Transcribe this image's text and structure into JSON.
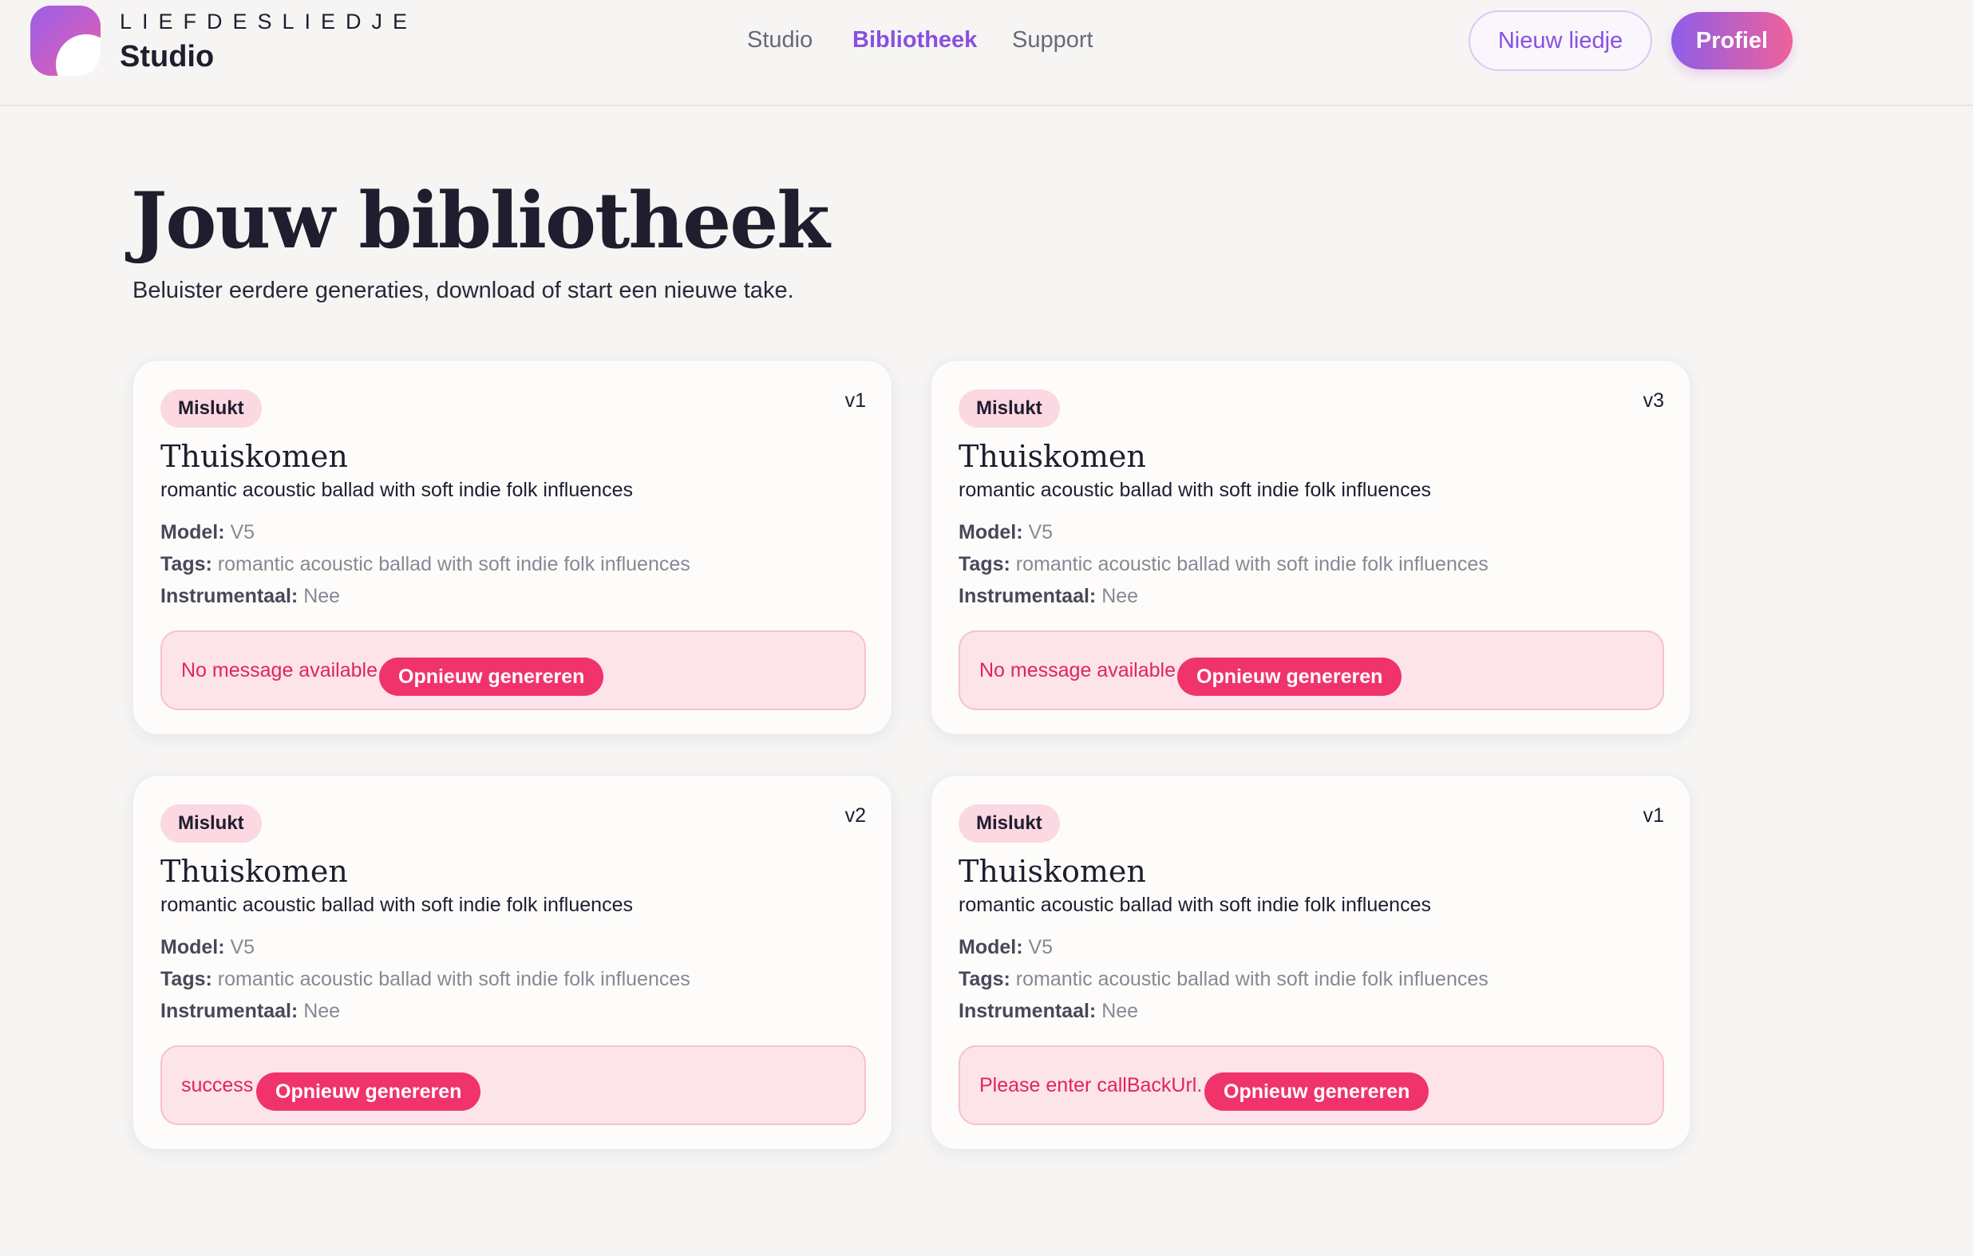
{
  "header": {
    "brand_top": "LIEFDESLIEDJE",
    "brand_bottom": "Studio",
    "nav": [
      {
        "label": "Studio",
        "active": false
      },
      {
        "label": "Bibliotheek",
        "active": true
      },
      {
        "label": "Support",
        "active": false
      }
    ],
    "new_song_label": "Nieuw liedje",
    "profile_label": "Profiel"
  },
  "page": {
    "title": "Jouw bibliotheek",
    "subtitle": "Beluister eerdere generaties, download of start een nieuwe take."
  },
  "labels": {
    "model": "Model:",
    "tags": "Tags:",
    "instrumental": "Instrumentaal:",
    "regenerate": "Opnieuw genereren"
  },
  "cards": [
    {
      "status": "Mislukt",
      "version": "v1",
      "title": "Thuiskomen",
      "description": "romantic acoustic ballad with soft indie folk influences",
      "model": "V5",
      "tags": "romantic acoustic ballad with soft indie folk influences",
      "instrumental": "Nee",
      "message": "No message available"
    },
    {
      "status": "Mislukt",
      "version": "v3",
      "title": "Thuiskomen",
      "description": "romantic acoustic ballad with soft indie folk influences",
      "model": "V5",
      "tags": "romantic acoustic ballad with soft indie folk influences",
      "instrumental": "Nee",
      "message": "No message available"
    },
    {
      "status": "Mislukt",
      "version": "v2",
      "title": "Thuiskomen",
      "description": "romantic acoustic ballad with soft indie folk influences",
      "model": "V5",
      "tags": "romantic acoustic ballad with soft indie folk influences",
      "instrumental": "Nee",
      "message": "success"
    },
    {
      "status": "Mislukt",
      "version": "v1",
      "title": "Thuiskomen",
      "description": "romantic acoustic ballad with soft indie folk influences",
      "model": "V5",
      "tags": "romantic acoustic ballad with soft indie folk influences",
      "instrumental": "Nee",
      "message": "Please enter callBackUrl."
    }
  ],
  "colors": {
    "accent": "#8a4fe0",
    "error": "#e0245e",
    "error_bg": "#fde4ea",
    "badge_bg": "#fbd8e2",
    "regen_button": "#f0336b"
  }
}
